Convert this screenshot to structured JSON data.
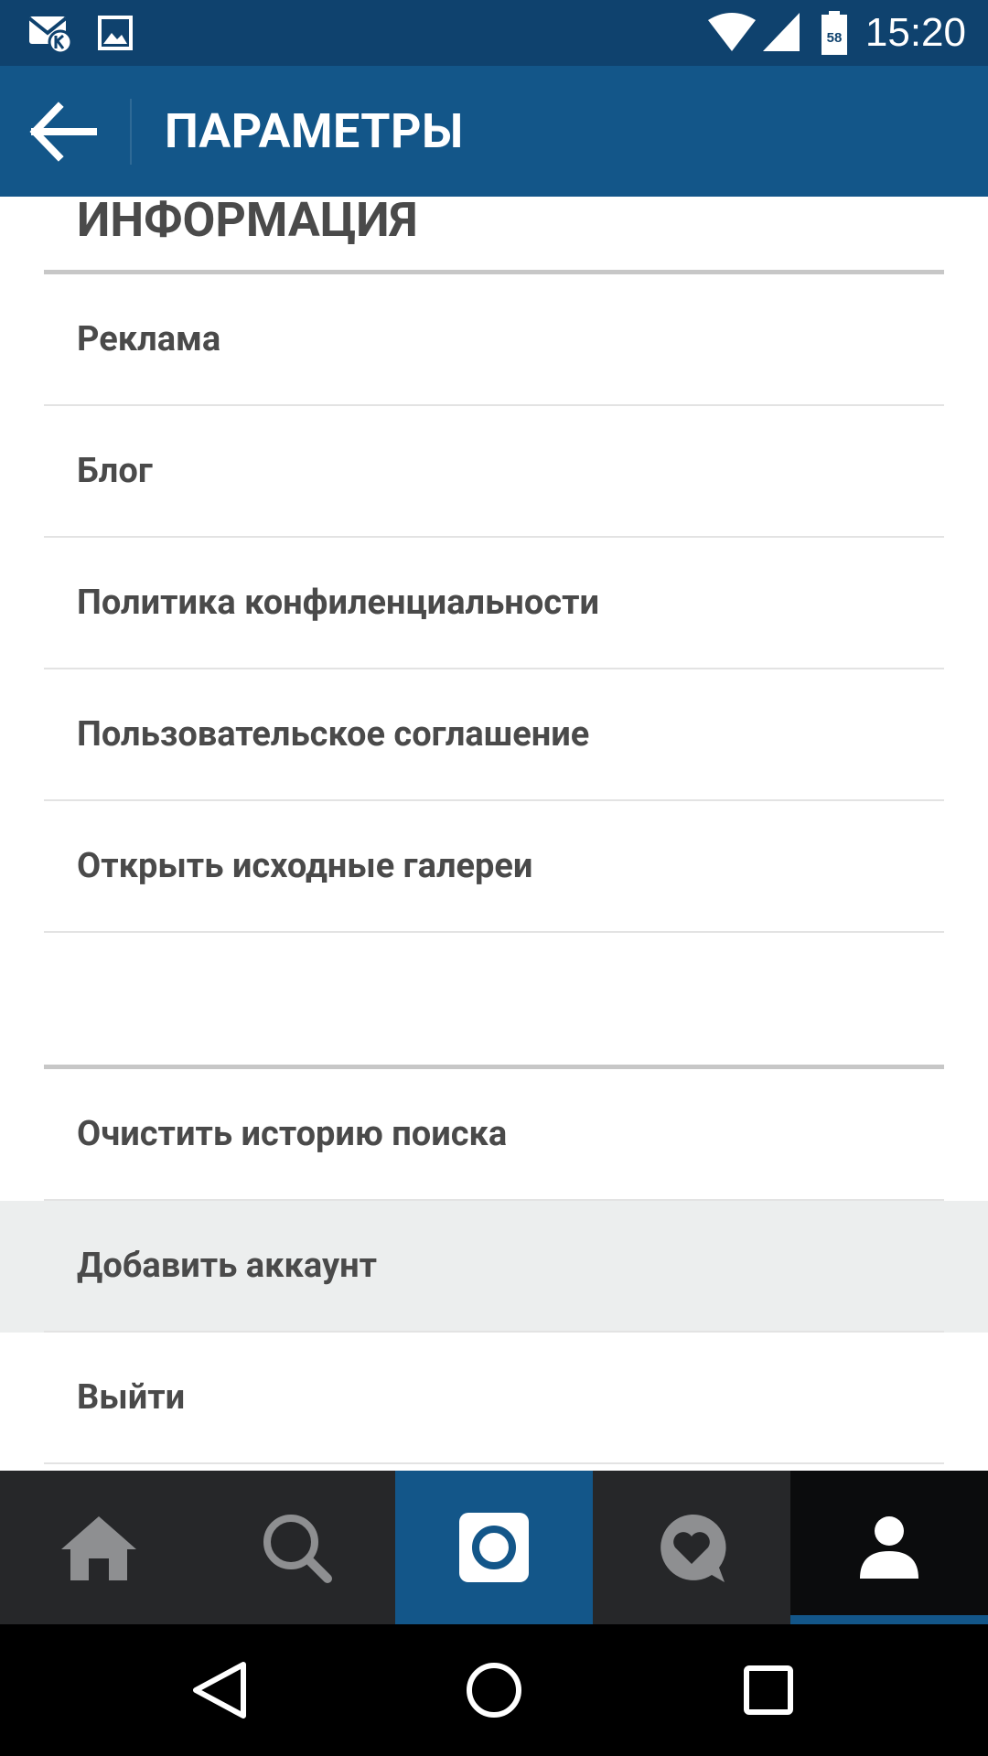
{
  "status_bar": {
    "time": "15:20",
    "battery_level": "58",
    "icons": [
      "mail-k-icon",
      "image-icon",
      "wifi-icon",
      "signal-icon",
      "battery-icon"
    ]
  },
  "action_bar": {
    "title": "ПАРАМЕТРЫ",
    "back_icon": "arrow-left-icon"
  },
  "section": {
    "title": "ИНФОРМАЦИЯ"
  },
  "info_items": [
    {
      "label": "Реклама"
    },
    {
      "label": "Блог"
    },
    {
      "label": "Политика конфиленциальности"
    },
    {
      "label": "Пользовательское соглашение"
    },
    {
      "label": "Открыть исходные галереи"
    }
  ],
  "account_items": [
    {
      "label": "Очистить историю поиска"
    },
    {
      "label": "Добавить аккаунт",
      "highlighted": true
    },
    {
      "label": "Выйти"
    }
  ],
  "tabs": [
    {
      "icon": "home-icon"
    },
    {
      "icon": "search-icon"
    },
    {
      "icon": "camera-icon"
    },
    {
      "icon": "activity-heart-icon"
    },
    {
      "icon": "profile-icon",
      "selected": true
    }
  ],
  "nav": {
    "icons": [
      "back-triangle-icon",
      "home-circle-icon",
      "recents-square-icon"
    ]
  },
  "colors": {
    "status_bar": "#0f426e",
    "action_bar": "#135689",
    "text": "#4a4a4a",
    "tab_bar": "#262729",
    "highlight": "#eceeee"
  }
}
